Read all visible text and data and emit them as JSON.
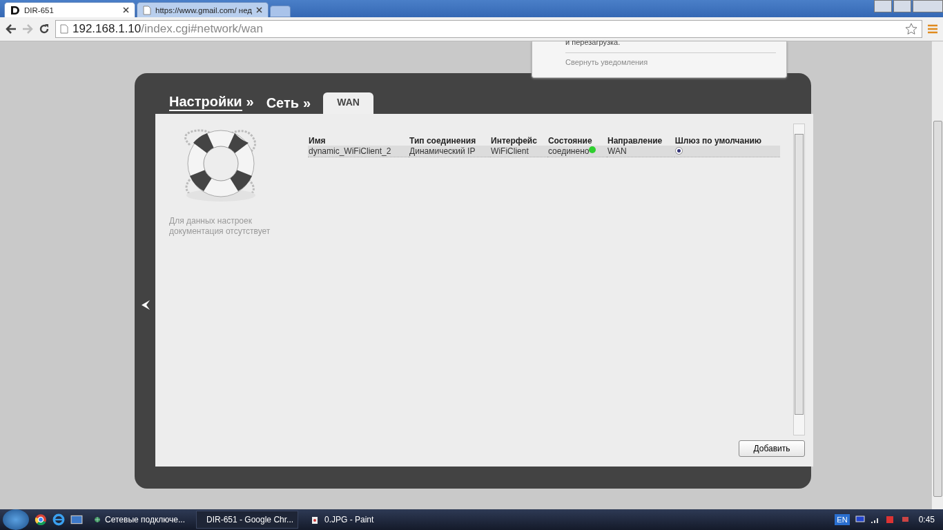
{
  "browser": {
    "tabs": [
      {
        "title": "DIR-651",
        "selected": true
      },
      {
        "title": "https://www.gmail.com/ нед",
        "selected": false
      }
    ],
    "address": {
      "host": "192.168.1.10",
      "path": "/index.cgi#network/wan"
    }
  },
  "notification": {
    "text": "и перезагрузка.",
    "collapse_link": "Свернуть уведомления"
  },
  "breadcrumbs": [
    {
      "label": "Настройки",
      "separator": "»",
      "link": true
    },
    {
      "label": "Сеть",
      "separator": "»",
      "link": false
    }
  ],
  "tab": {
    "label": "WAN",
    "selected": true
  },
  "help_text": "Для данных настроек документация отсутствует",
  "table": {
    "columns": [
      "Имя",
      "Тип соединения",
      "Интерфейс",
      "Состояние",
      "Направление",
      "Шлюз по умолчанию"
    ],
    "rows": [
      {
        "name": "dynamic_WiFiClient_2",
        "type": "Динамический IP",
        "interface": "WiFiClient",
        "status": "соединено",
        "color": "#2fcf2f",
        "direction": "WAN",
        "default_gateway": true
      }
    ]
  },
  "add_button": "Добавить",
  "taskbar": {
    "items": [
      {
        "title": "Сетевые подключе...",
        "selected": false
      },
      {
        "title": "DIR-651 - Google Chr...",
        "selected": true
      },
      {
        "title": "0.JPG - Paint",
        "selected": false
      }
    ],
    "language": "EN",
    "time": "0:45"
  }
}
